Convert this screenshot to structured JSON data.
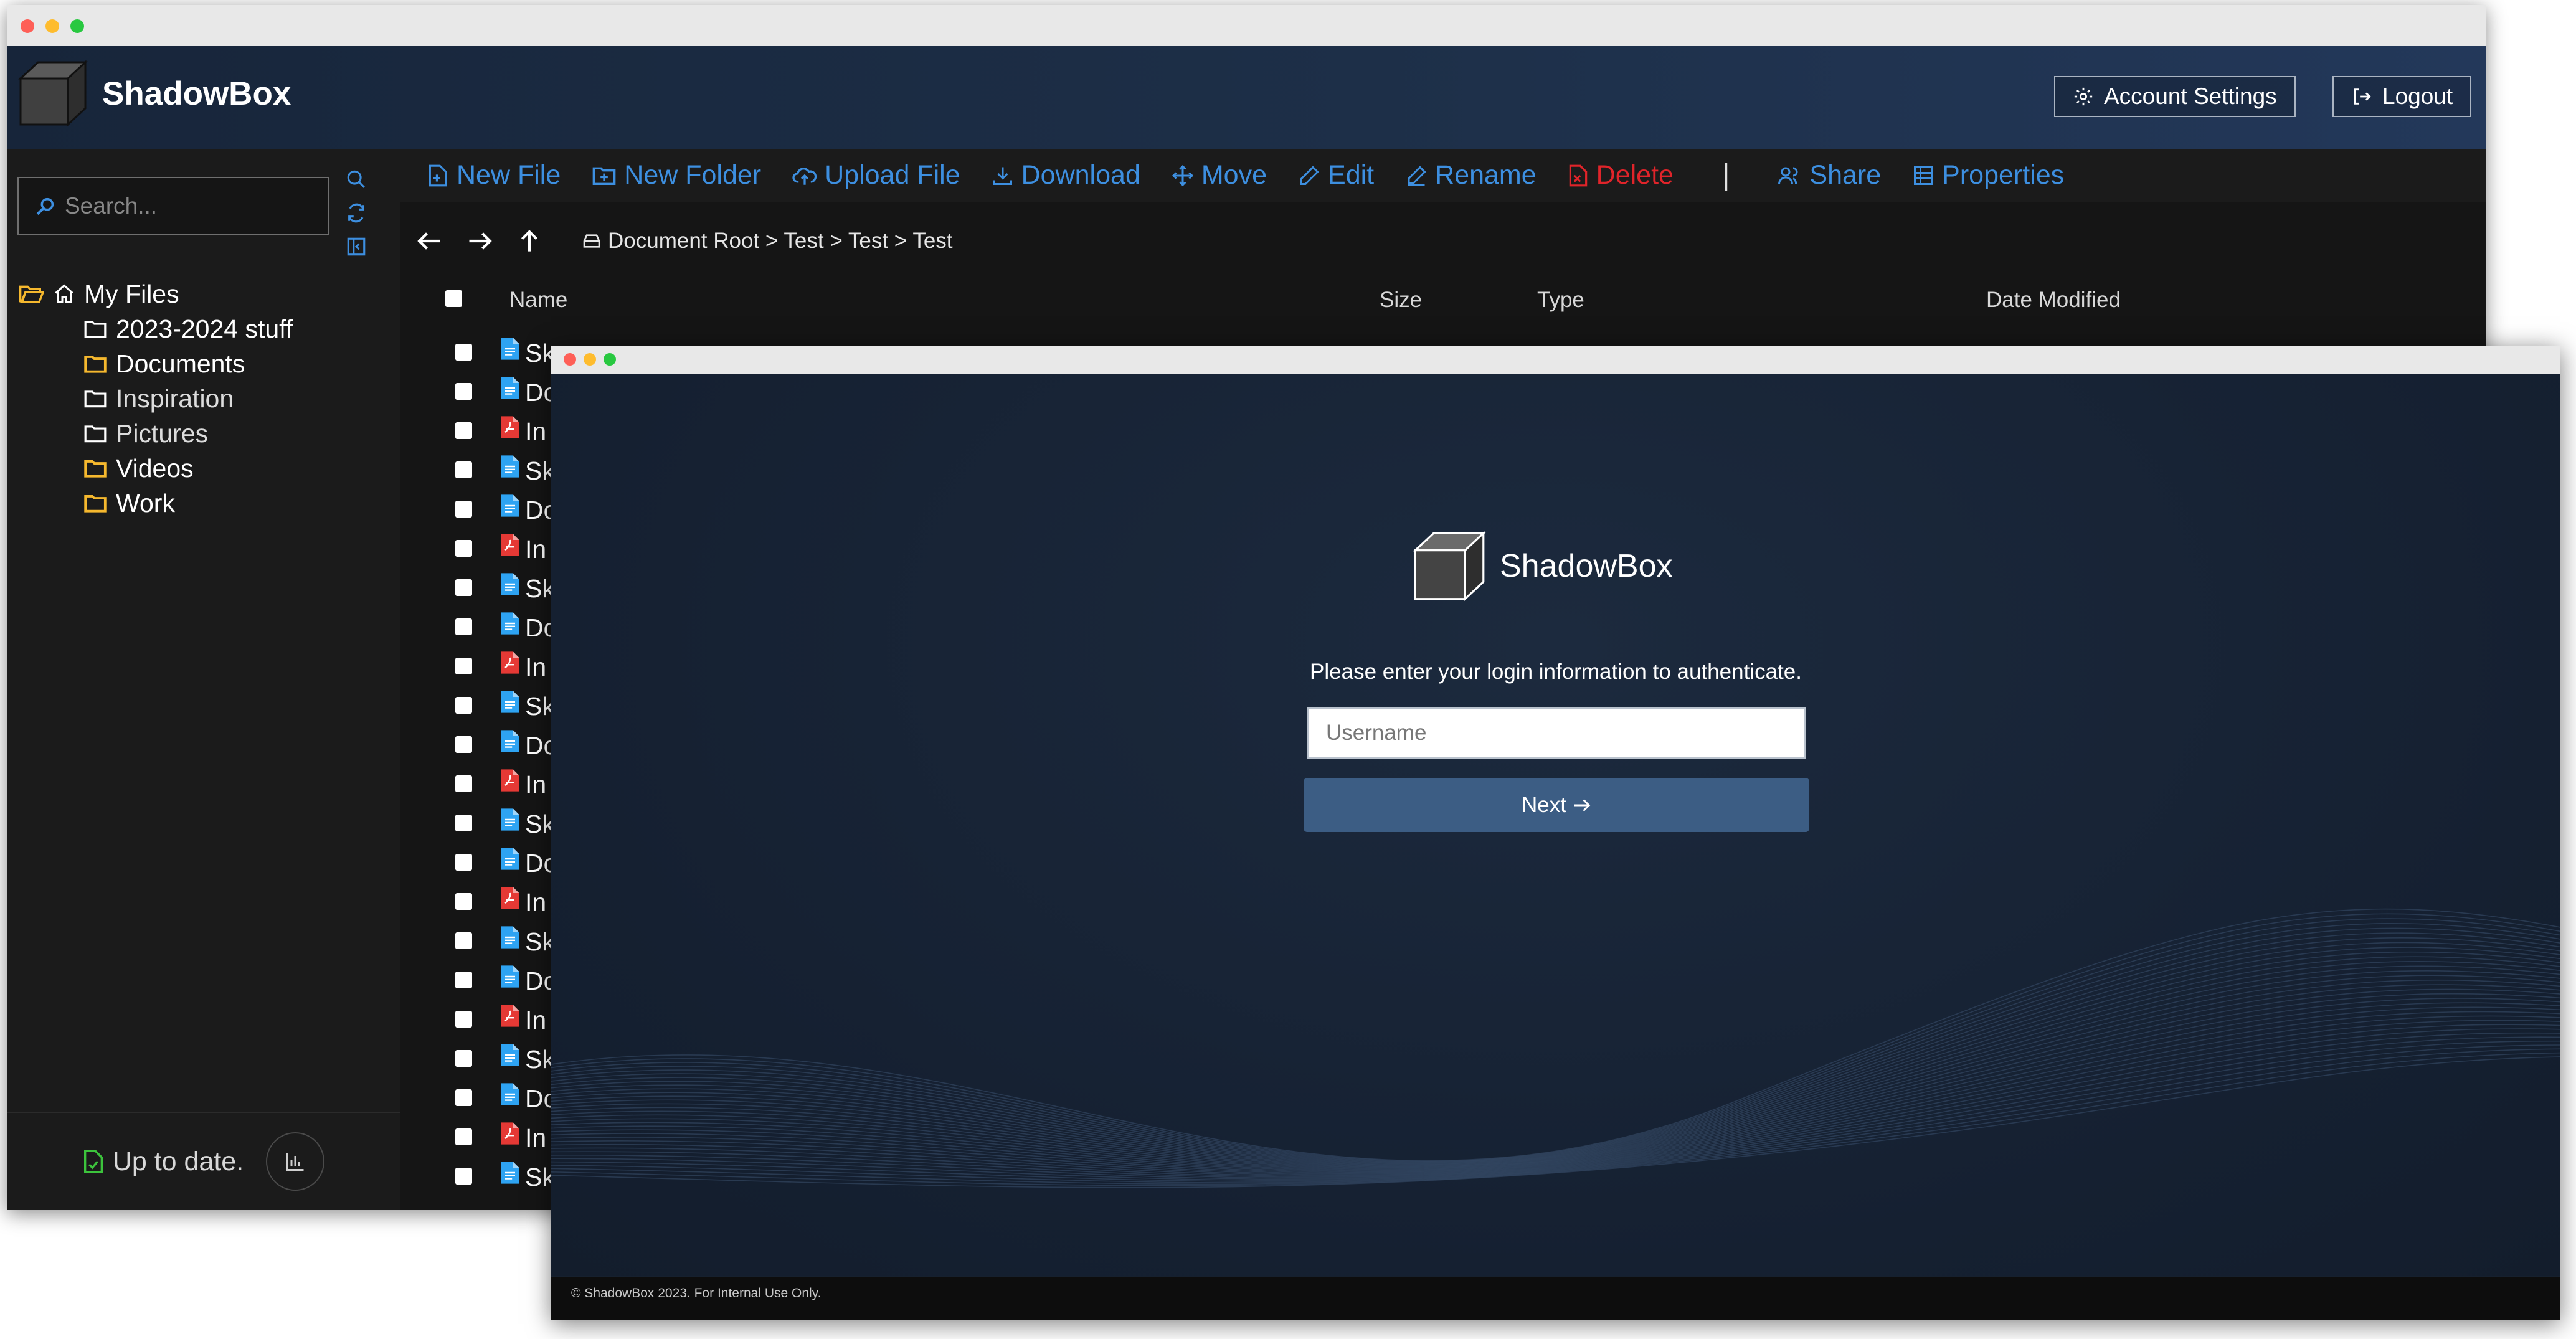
{
  "file_manager": {
    "brand": "ShadowBox",
    "header_buttons": {
      "account_settings": "Account Settings",
      "logout": "Logout"
    },
    "search_placeholder": "Search...",
    "tree": {
      "root": "My Files",
      "folders": [
        {
          "label": "2023-2024 stuff",
          "icon": "folder-outline-icon"
        },
        {
          "label": "Documents",
          "icon": "folder-filled-icon"
        },
        {
          "label": "Inspiration",
          "icon": "folder-outline-icon"
        },
        {
          "label": "Pictures",
          "icon": "folder-outline-icon"
        },
        {
          "label": "Videos",
          "icon": "folder-filled-icon"
        },
        {
          "label": "Work",
          "icon": "folder-filled-icon"
        }
      ]
    },
    "status": "Up to date.",
    "toolbar": {
      "new_file": "New File",
      "new_folder": "New Folder",
      "upload_file": "Upload File",
      "download": "Download",
      "move": "Move",
      "edit": "Edit",
      "rename": "Rename",
      "delete": "Delete",
      "separator": "|",
      "share": "Share",
      "properties": "Properties"
    },
    "breadcrumb": "Document Root > Test > Test > Test",
    "columns": {
      "name": "Name",
      "size": "Size",
      "type": "Type",
      "date_modified": "Date Modified"
    },
    "rows": [
      {
        "prefix": "Sk",
        "kind": "doc"
      },
      {
        "prefix": "Do",
        "kind": "doc"
      },
      {
        "prefix": "In",
        "kind": "pdf"
      },
      {
        "prefix": "Sk",
        "kind": "doc"
      },
      {
        "prefix": "Do",
        "kind": "doc"
      },
      {
        "prefix": "In",
        "kind": "pdf"
      },
      {
        "prefix": "Sk",
        "kind": "doc"
      },
      {
        "prefix": "Do",
        "kind": "doc"
      },
      {
        "prefix": "In",
        "kind": "pdf"
      },
      {
        "prefix": "Sk",
        "kind": "doc"
      },
      {
        "prefix": "Do",
        "kind": "doc"
      },
      {
        "prefix": "In",
        "kind": "pdf"
      },
      {
        "prefix": "Sk",
        "kind": "doc"
      },
      {
        "prefix": "Do",
        "kind": "doc"
      },
      {
        "prefix": "In",
        "kind": "pdf"
      },
      {
        "prefix": "Sk",
        "kind": "doc"
      },
      {
        "prefix": "Do",
        "kind": "doc"
      },
      {
        "prefix": "In",
        "kind": "pdf"
      },
      {
        "prefix": "Sk",
        "kind": "doc"
      },
      {
        "prefix": "Do",
        "kind": "doc"
      },
      {
        "prefix": "In",
        "kind": "pdf"
      },
      {
        "prefix": "Sk",
        "kind": "doc"
      }
    ]
  },
  "login": {
    "brand": "ShadowBox",
    "prompt": "Please enter your login information to authenticate.",
    "username_placeholder": "Username",
    "next_label": "Next",
    "footer": "© ShadowBox 2023. For Internal Use Only."
  },
  "colors": {
    "accent_blue": "#3d8fe0",
    "delete_red": "#e0242a",
    "folder_yellow": "#f5b82e",
    "status_green": "#3cc43c",
    "header_navy": "#1d2f48",
    "login_button": "#3c5d84"
  }
}
